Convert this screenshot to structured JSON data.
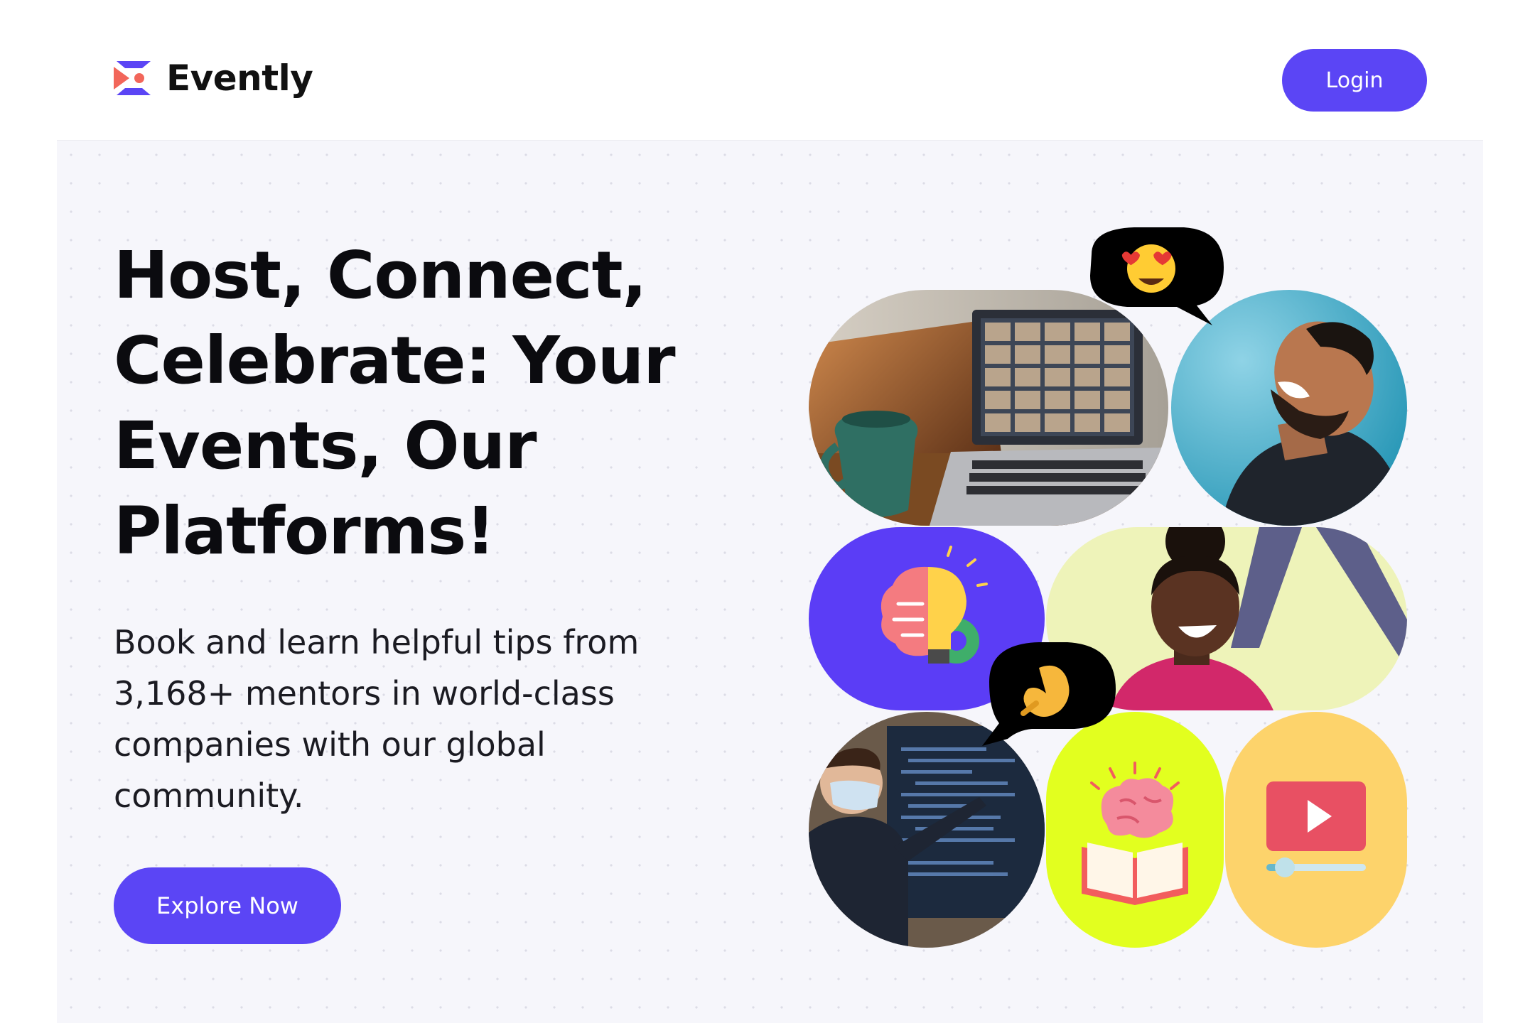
{
  "brand": {
    "name": "Evently"
  },
  "header": {
    "login_label": "Login"
  },
  "hero": {
    "title": "Host, Connect, Celebrate: Your Events, Our Platforms!",
    "subtitle": "Book and learn helpful tips from 3,168+ mentors in world-class companies with our global community.",
    "cta_label": "Explore Now"
  },
  "colors": {
    "accent": "#5b45f5",
    "logo_coral": "#f2665a",
    "tile_purple": "#5b3df6",
    "tile_lime": "#e2ff1f",
    "tile_yellow": "#fdd36b",
    "background": "#f6f6fb"
  },
  "collage": {
    "tiles": [
      {
        "name": "video-call-laptop-photo"
      },
      {
        "name": "laughing-man-photo"
      },
      {
        "name": "brain-lightbulb-icon"
      },
      {
        "name": "smiling-woman-photo"
      },
      {
        "name": "presenter-masked-photo"
      },
      {
        "name": "brain-book-icon"
      },
      {
        "name": "video-play-icon"
      }
    ],
    "bubbles": [
      {
        "name": "heart-eyes-emoji-bubble",
        "emoji": "😍"
      },
      {
        "name": "pinched-fingers-emoji-bubble",
        "emoji": "🤌"
      }
    ]
  }
}
